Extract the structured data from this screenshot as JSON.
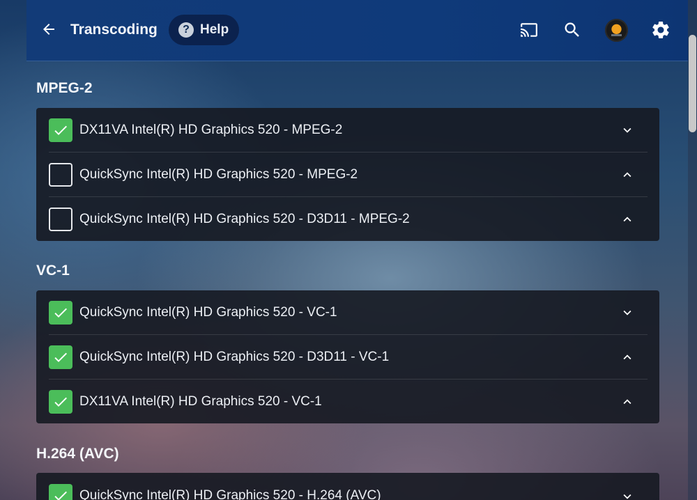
{
  "header": {
    "title": "Transcoding",
    "help_label": "Help",
    "icons": [
      "arrow-back-icon",
      "cast-icon",
      "search-icon",
      "avatar",
      "gear-icon"
    ]
  },
  "sections": [
    {
      "title": "MPEG-2",
      "rows": [
        {
          "label": "DX11VA Intel(R) HD Graphics 520 - MPEG-2",
          "checked": true,
          "chevron": "down"
        },
        {
          "label": "QuickSync Intel(R) HD Graphics 520 - MPEG-2",
          "checked": false,
          "chevron": "up"
        },
        {
          "label": "QuickSync Intel(R) HD Graphics 520 - D3D11 - MPEG-2",
          "checked": false,
          "chevron": "up"
        }
      ]
    },
    {
      "title": "VC-1",
      "rows": [
        {
          "label": "QuickSync Intel(R) HD Graphics 520 - VC-1",
          "checked": true,
          "chevron": "down"
        },
        {
          "label": "QuickSync Intel(R) HD Graphics 520 - D3D11 - VC-1",
          "checked": true,
          "chevron": "up"
        },
        {
          "label": "DX11VA Intel(R) HD Graphics 520 - VC-1",
          "checked": true,
          "chevron": "up"
        }
      ]
    },
    {
      "title": "H.264 (AVC)",
      "rows": [
        {
          "label": "QuickSync Intel(R) HD Graphics 520 - H.264 (AVC)",
          "checked": true,
          "chevron": "down"
        }
      ]
    }
  ],
  "colors": {
    "header_bg": "#123b78",
    "checkbox_checked": "#4bbd5a",
    "card_bg": "#161a22"
  }
}
